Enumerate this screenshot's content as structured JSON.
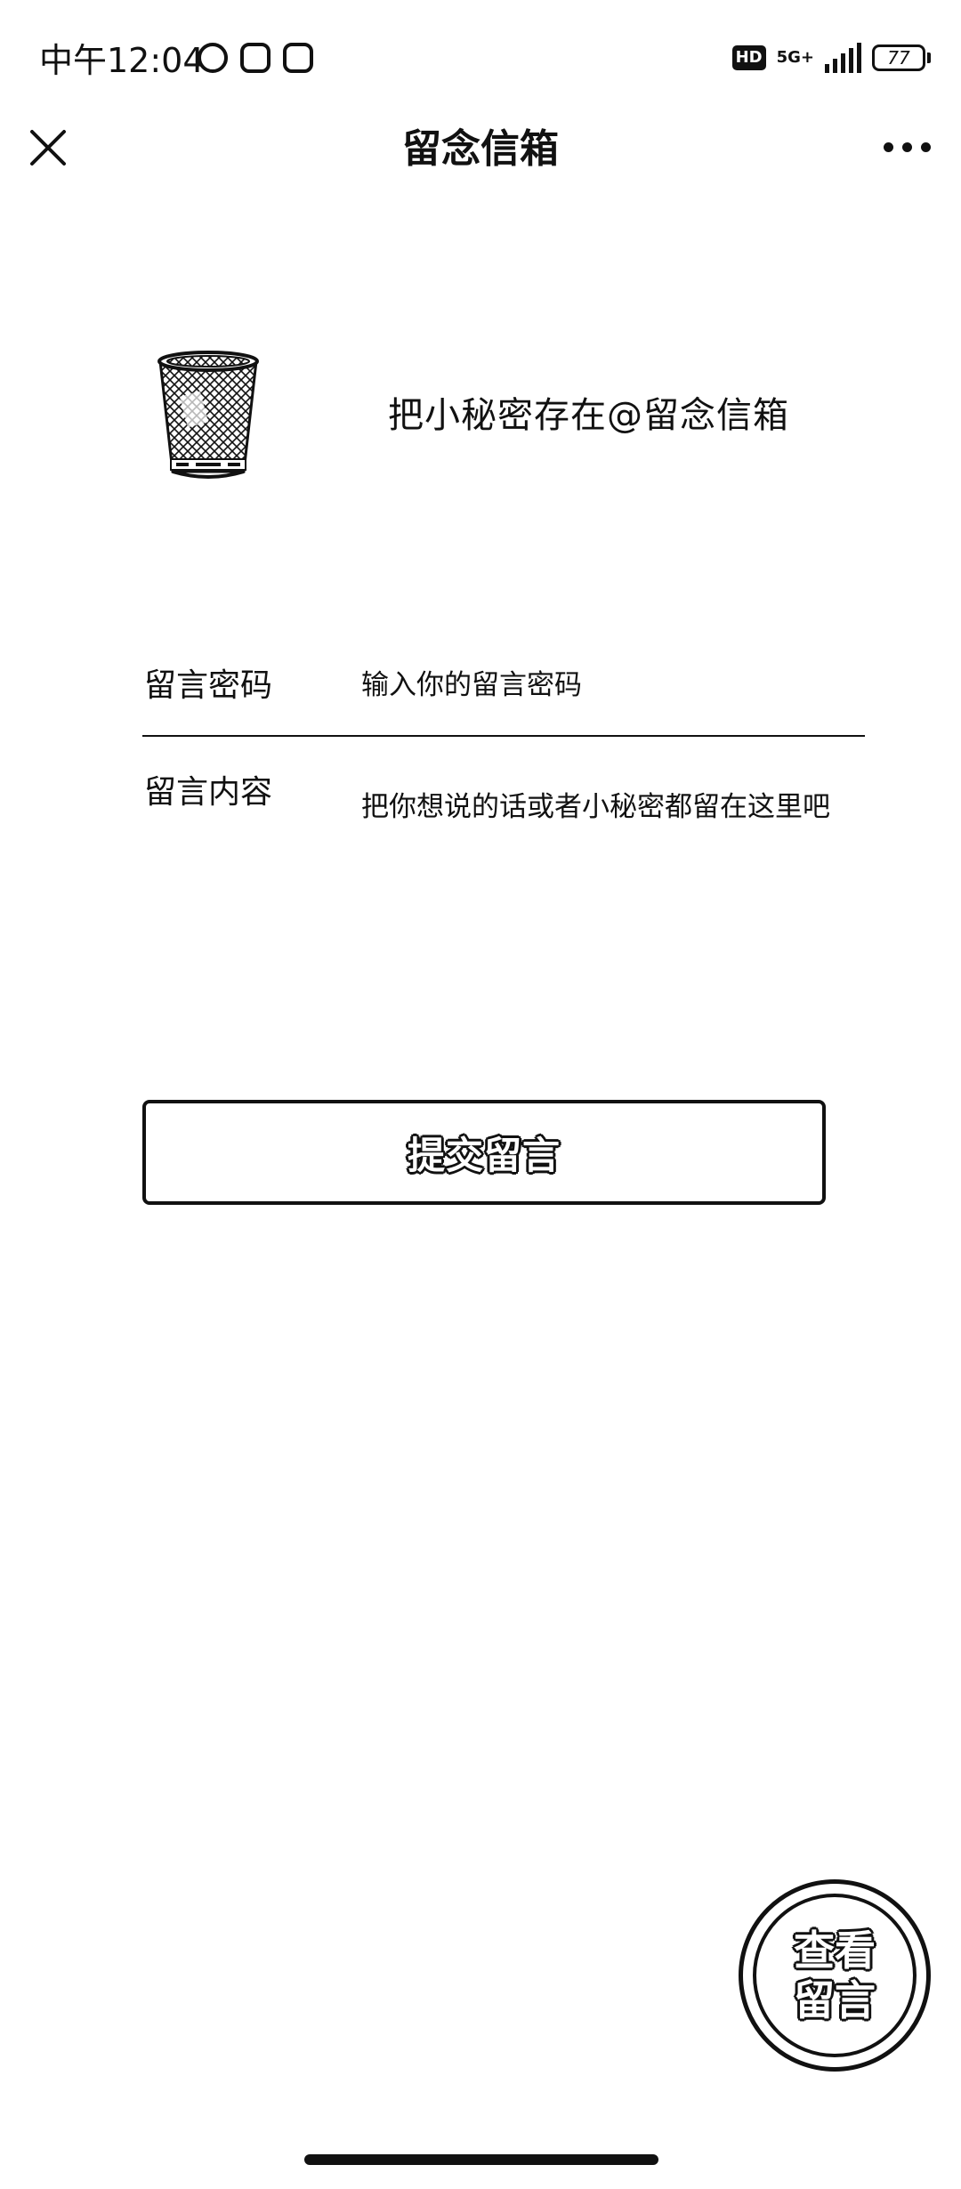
{
  "status_bar": {
    "time": "中午12:04",
    "hd_badge": "HD",
    "network": "5G+",
    "battery": "77"
  },
  "nav": {
    "title": "留念信箱"
  },
  "hero": {
    "slogan": "把小秘密存在@留念信箱"
  },
  "form": {
    "password_label": "留言密码",
    "password_placeholder": "输入你的留言密码",
    "content_label": "留言内容",
    "content_placeholder": "把你想说的话或者小秘密都留在这里吧"
  },
  "buttons": {
    "submit_label": "提交留言",
    "view_line1": "查看",
    "view_line2": "留言"
  },
  "colors": {
    "foreground": "#111111",
    "background": "#ffffff"
  }
}
